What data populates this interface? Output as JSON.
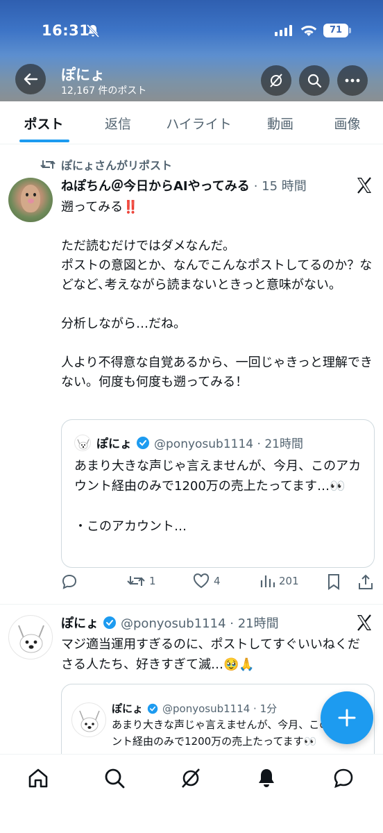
{
  "status_bar": {
    "time": "16:31",
    "battery": "71"
  },
  "header": {
    "name": "ぽにょ",
    "post_count": "12,167 件のポスト"
  },
  "tabs": [
    {
      "label": "ポスト",
      "active": true
    },
    {
      "label": "返信"
    },
    {
      "label": "ハイライト"
    },
    {
      "label": "動画"
    },
    {
      "label": "画像"
    }
  ],
  "post1": {
    "repost_label": "ぽにょさんがリポスト",
    "author": "ねぽちん＠今日からAIやってみる",
    "time": "· 15 時間",
    "body": "遡ってみる‼️\n\nただ読むだけではダメなんだ。\nポストの意図とか、なんでこんなポストしてるのか？などなど､考えながら読まないときっと意味がない。\n\n分析しながら…だね。\n\n人より不得意な自覚あるから、一回じゃきっと理解できない。何度も何度も遡ってみる！",
    "quote": {
      "name": "ぽにょ",
      "handle": "@ponyosub1114 · 21時間",
      "body": "あまり大きな声じゃ言えませんが、今月、このアカウント経由のみで1200万の売上たってます…👀\n\n・このアカウント…"
    },
    "actions": {
      "reply": "",
      "repost": "1",
      "like": "4",
      "views": "201"
    }
  },
  "post2": {
    "author": "ぽにょ",
    "handle_time": "@ponyosub1114 · 21時間",
    "body": "マジ適当運用すぎるのに、ポストしてすぐいいねくださる人たち、好きすぎて滅…🥹🙏",
    "quote": {
      "name": "ぽにょ",
      "handle": "@ponyosub1114 · 1分",
      "body": "あまり大きな声じゃ言えませんが、今月、このアカウント経由のみで1200万の売上たってます👀"
    }
  },
  "colors": {
    "accent": "#1d9bf0",
    "secondary_text": "#536471",
    "verified": "#1d9bf0"
  },
  "icons": {
    "back": "arrow-left-icon",
    "grok": "grok-icon",
    "search": "search-icon",
    "more": "more-icon",
    "nav": [
      "home-icon",
      "search-icon",
      "grok-icon",
      "notifications-icon",
      "messages-icon"
    ]
  }
}
